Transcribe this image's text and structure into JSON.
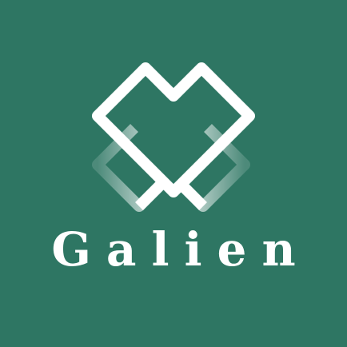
{
  "brand": {
    "name": "Galien",
    "background_color": "#2e7663",
    "mark_color": "#ffffff",
    "logo_icon": "heart-diamond-logo-icon"
  }
}
